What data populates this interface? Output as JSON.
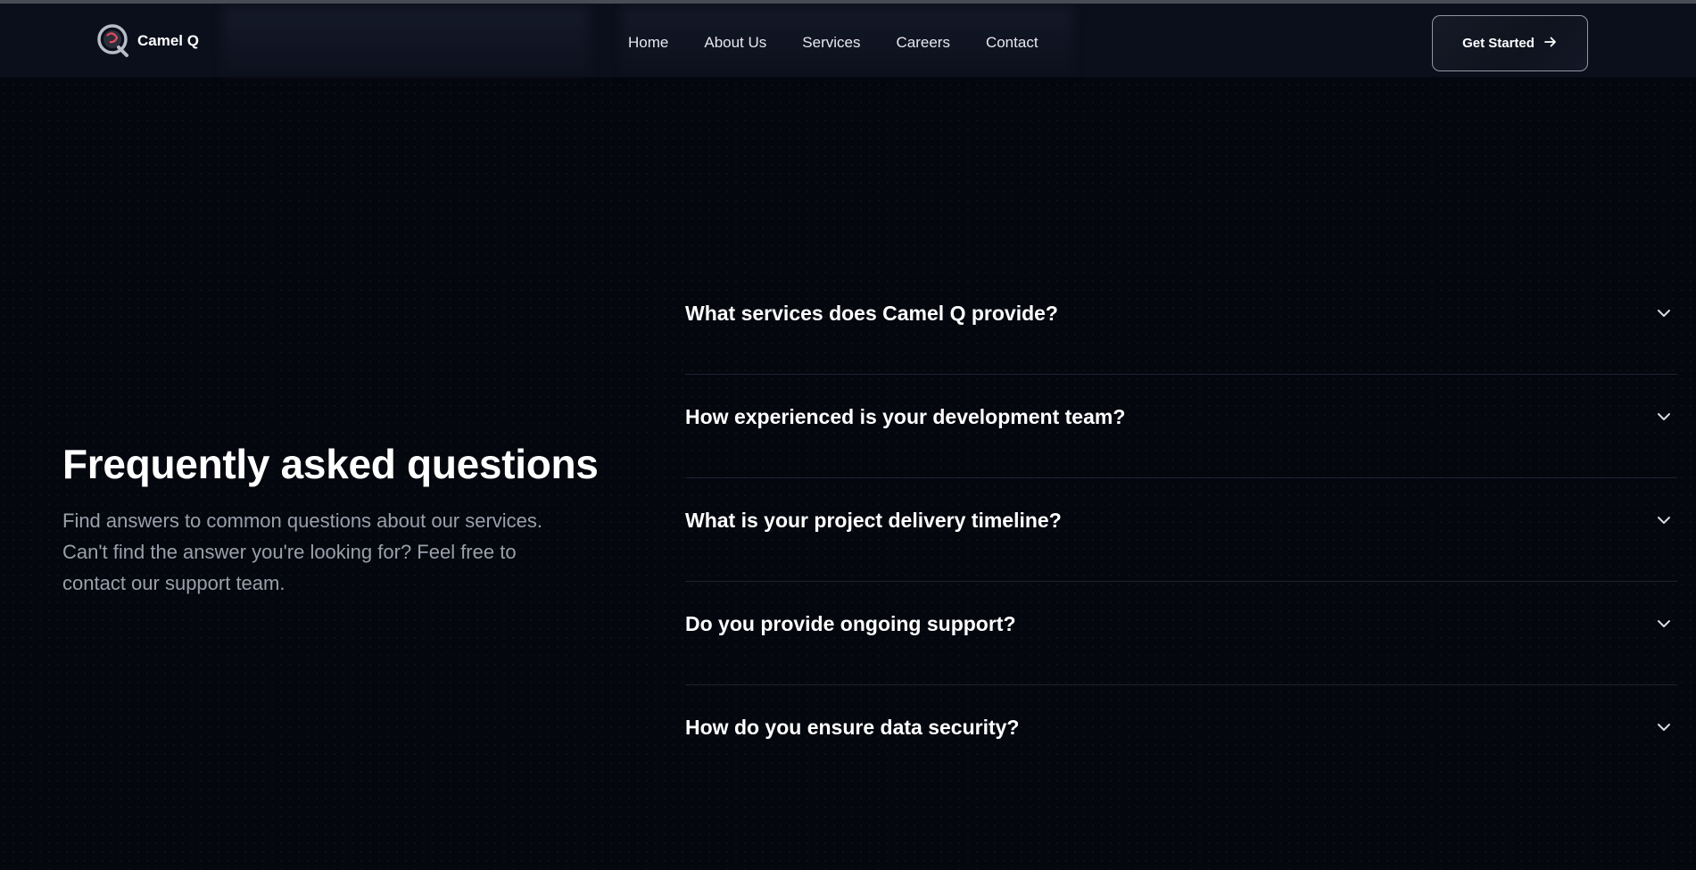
{
  "brand": {
    "name": "Camel Q",
    "logo_icon": "camel-q-logo"
  },
  "nav": {
    "items": [
      {
        "label": "Home"
      },
      {
        "label": "About Us"
      },
      {
        "label": "Services"
      },
      {
        "label": "Careers"
      },
      {
        "label": "Contact"
      }
    ],
    "cta_label": "Get Started",
    "cta_icon": "arrow-right-icon"
  },
  "faq": {
    "title": "Frequently asked questions",
    "description": "Find answers to common questions about our services. Can't find the answer you're looking for? Feel free to contact our support team.",
    "items": [
      {
        "question": "What services does Camel Q provide?",
        "icon": "chevron-down-icon"
      },
      {
        "question": "How experienced is your development team?",
        "icon": "chevron-down-icon"
      },
      {
        "question": "What is your project delivery timeline?",
        "icon": "chevron-down-icon"
      },
      {
        "question": "Do you provide ongoing support?",
        "icon": "chevron-down-icon"
      },
      {
        "question": "How do you ensure data security?",
        "icon": "chevron-down-icon"
      }
    ]
  },
  "colors": {
    "background": "#05070f",
    "header": "#0b0f1b",
    "text_muted": "#9aa0ab",
    "divider": "#1e2330"
  }
}
